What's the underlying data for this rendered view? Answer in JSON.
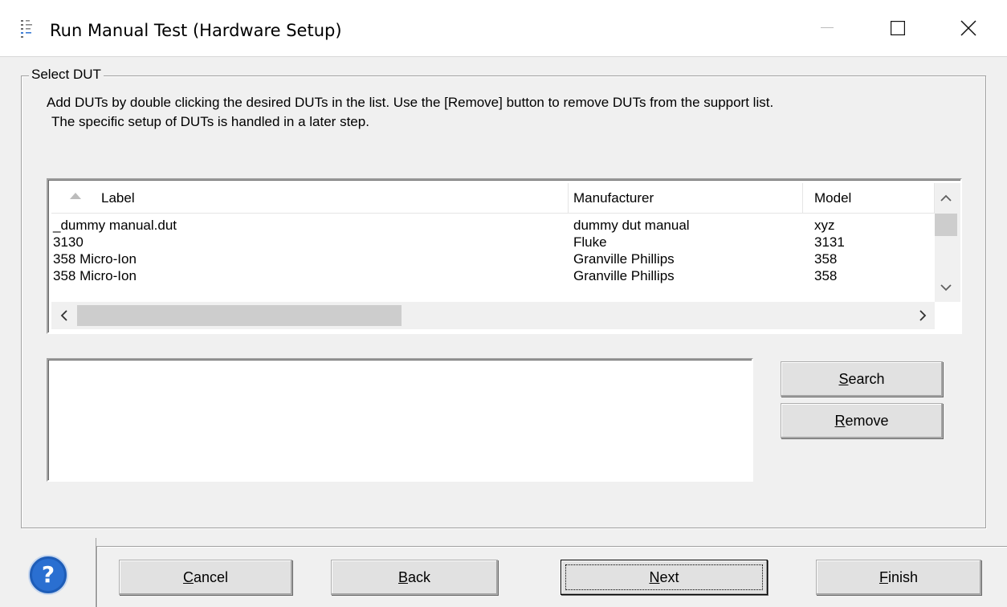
{
  "window": {
    "title": "Run Manual Test (Hardware Setup)",
    "icon": "list-gauge-icon",
    "controls": [
      "minimize-icon",
      "maximize-icon",
      "close-icon"
    ]
  },
  "group": {
    "legend": "Select DUT",
    "instructions_line1": "Add DUTs by double clicking the desired DUTs in the list.  Use the [Remove] button to remove DUTs from the support list.",
    "instructions_line2": "The specific setup of DUTs is handled in a later step."
  },
  "dut_table": {
    "columns": [
      "Label",
      "Manufacturer",
      "Model"
    ],
    "sort_indicator": "ascending",
    "rows": [
      {
        "label": "_dummy manual.dut",
        "manufacturer": "dummy dut manual",
        "model": "xyz"
      },
      {
        "label": "3130",
        "manufacturer": "Fluke",
        "model": "3131"
      },
      {
        "label": "358 Micro-Ion",
        "manufacturer": "Granville Phillips",
        "model": "358"
      },
      {
        "label": "358 Micro-Ion",
        "manufacturer": "Granville Phillips",
        "model": "358"
      }
    ]
  },
  "support_list": {
    "items": []
  },
  "side_buttons": {
    "search_prefix": "S",
    "search_rest": "earch",
    "remove_prefix": "R",
    "remove_rest": "emove"
  },
  "footer": {
    "cancel_prefix": "C",
    "cancel_rest": "ancel",
    "back_prefix": "B",
    "back_rest": "ack",
    "next_prefix": "N",
    "next_rest": "ext",
    "finish_prefix": "F",
    "finish_rest": "inish",
    "help_icon": "question-help-icon"
  },
  "colors": {
    "dialog_bg": "#f0f0f0",
    "titlebar_bg": "#ffffff",
    "help_blue": "#1e5db8"
  }
}
